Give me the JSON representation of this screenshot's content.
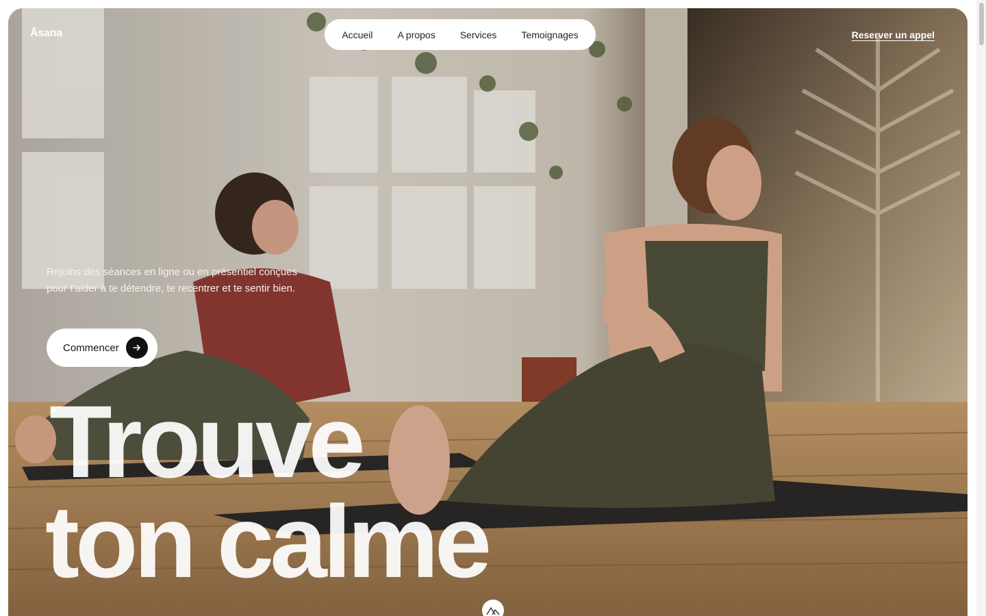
{
  "brand": {
    "logo": "Āsana"
  },
  "nav": {
    "items": [
      {
        "label": "Accueil"
      },
      {
        "label": "A propos"
      },
      {
        "label": "Services"
      },
      {
        "label": "Temoignages"
      }
    ]
  },
  "header": {
    "cta_label": "Reserver un appel"
  },
  "hero": {
    "tagline": "Rejoins des séances en ligne ou en présentiel conçues pour t'aider à te détendre, te recentrer et te sentir bien.",
    "button_label": "Commencer",
    "headline_line1": "Trouve",
    "headline_line2": "ton calme",
    "image_icon": "yoga-studio-photo"
  },
  "icons": {
    "button_arrow": "arrow-right-icon",
    "badge": "mountain-logo-icon"
  },
  "colors": {
    "button_bg": "#ffffff",
    "arrow_circle": "#111111",
    "headline": "#ffffff"
  }
}
